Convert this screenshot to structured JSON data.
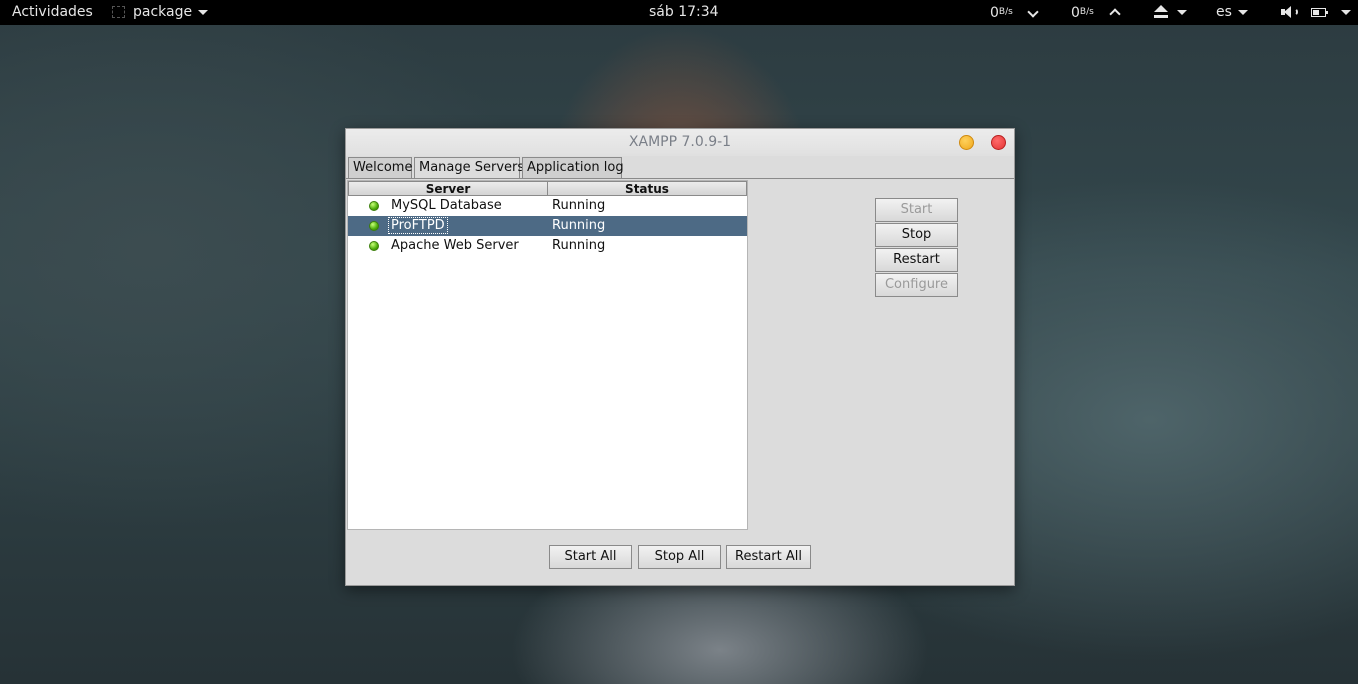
{
  "topbar": {
    "activities": "Actividades",
    "app_name": "package",
    "clock": "sáb 17:34",
    "net_down_value": "0",
    "net_down_unit": "B/s",
    "net_up_value": "0",
    "net_up_unit": "B/s",
    "keyboard_layout": "es"
  },
  "window": {
    "title": "XAMPP 7.0.9-1",
    "tabs": [
      {
        "label": "Welcome",
        "active": false
      },
      {
        "label": "Manage Servers",
        "active": true
      },
      {
        "label": "Application log",
        "active": false
      }
    ],
    "table": {
      "columns": [
        "Server",
        "Status"
      ],
      "rows": [
        {
          "server": "MySQL Database",
          "status": "Running",
          "selected": false
        },
        {
          "server": "ProFTPD",
          "status": "Running",
          "selected": true
        },
        {
          "server": "Apache Web Server",
          "status": "Running",
          "selected": false
        }
      ]
    },
    "side_buttons": {
      "start": "Start",
      "stop": "Stop",
      "restart": "Restart",
      "configure": "Configure"
    },
    "bottom_buttons": {
      "start_all": "Start All",
      "stop_all": "Stop All",
      "restart_all": "Restart All"
    }
  },
  "colors": {
    "selection": "#4d6a85",
    "status_running": "#4fae0c",
    "close": "#e33434",
    "minimize": "#f0a81c"
  }
}
